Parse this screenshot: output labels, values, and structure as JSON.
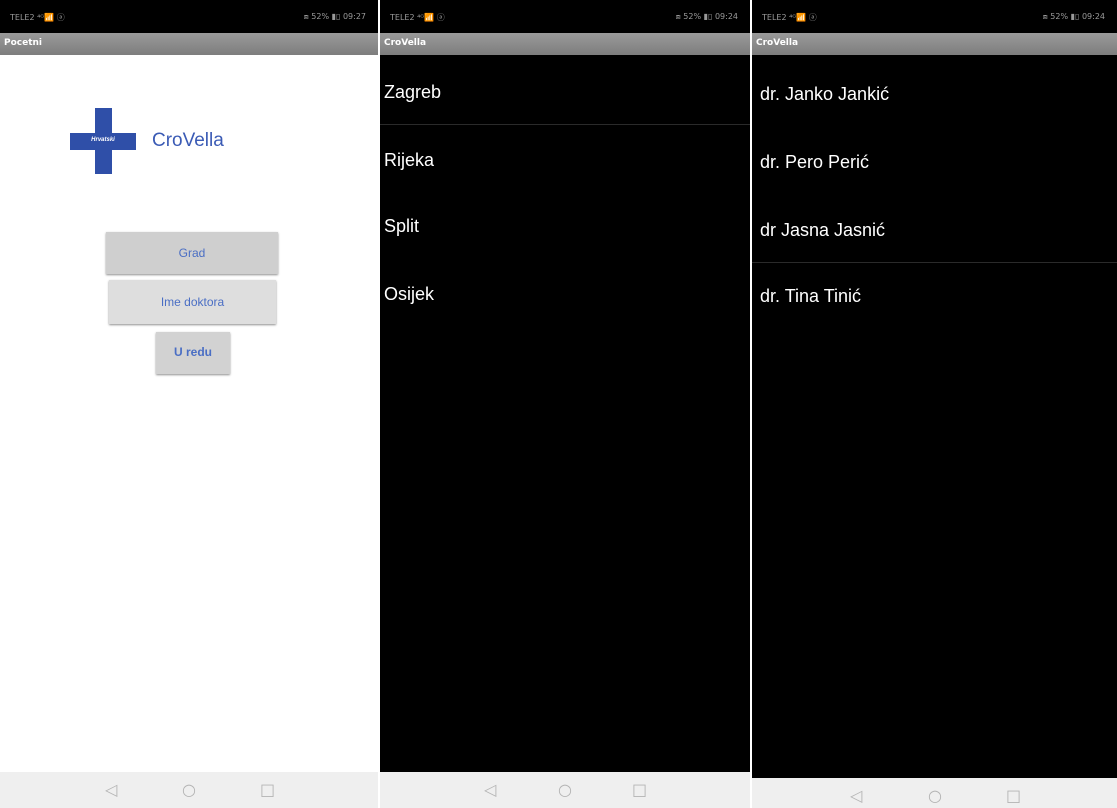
{
  "screens": [
    {
      "status_left": "TELE2 ⁴ᴳ📶 ⓐ",
      "status_right": "⧈ 52% ▮▯ 09:27",
      "title": "Pocetni",
      "app_name": "CroVella",
      "logo_text": "Hrvatski",
      "buttons": {
        "grad": "Grad",
        "ime_doktora": "Ime doktora",
        "u_redu": "U redu"
      }
    },
    {
      "status_left": "TELE2 ⁴ᴳ📶 ⓐ",
      "status_right": "⧈ 52% ▮▯ 09:24",
      "title": "CroVella",
      "cities": [
        "Zagreb",
        "Rijeka",
        "Split",
        "Osijek"
      ]
    },
    {
      "status_left": "TELE2 ⁴ᴳ📶 ⓐ",
      "status_right": "⧈ 52% ▮▯ 09:24",
      "title": "CroVella",
      "doctors": [
        "dr. Janko Jankić",
        "dr. Pero Perić",
        "dr Jasna Jasnić",
        "dr. Tina Tinić"
      ]
    }
  ],
  "navbar": {
    "back_icon": "◁",
    "home_icon": "○",
    "recent_icon": "□"
  }
}
